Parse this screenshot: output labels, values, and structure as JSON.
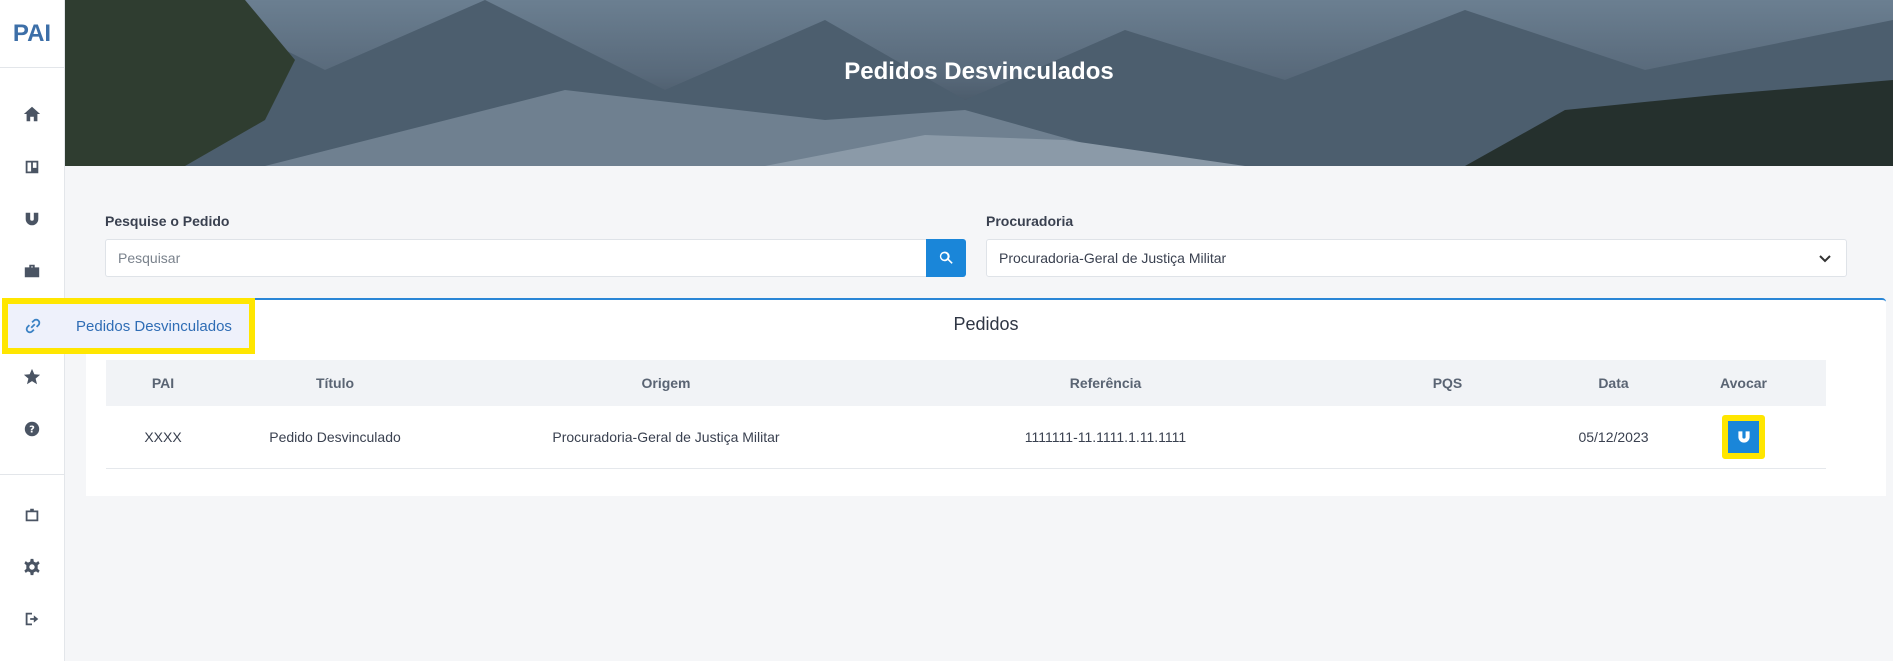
{
  "app": {
    "logo": "PAI"
  },
  "sidebar": {
    "active_label": "Pedidos Desvinculados",
    "icons": [
      "home-icon",
      "board-icon",
      "magnet-icon",
      "briefcase-icon",
      "link-icon",
      "star-icon",
      "help-icon",
      "building-icon",
      "gear-icon",
      "logout-icon"
    ]
  },
  "hero": {
    "title": "Pedidos Desvinculados"
  },
  "filters": {
    "search_label": "Pesquise o Pedido",
    "search_placeholder": "Pesquisar",
    "procuradoria_label": "Procuradoria",
    "procuradoria_value": "Procuradoria-Geral de Justiça Militar"
  },
  "card": {
    "title": "Pedidos",
    "columns": [
      "PAI",
      "Título",
      "Origem",
      "Referência",
      "PQS",
      "Data",
      "Avocar"
    ],
    "rows": [
      {
        "pai": "XXXX",
        "titulo": "Pedido Desvinculado",
        "origem": "Procuradoria-Geral de Justiça Militar",
        "referencia": "1111111-11.1111.1.11.1111",
        "pqs": "",
        "data": "05/12/2023"
      }
    ]
  }
}
